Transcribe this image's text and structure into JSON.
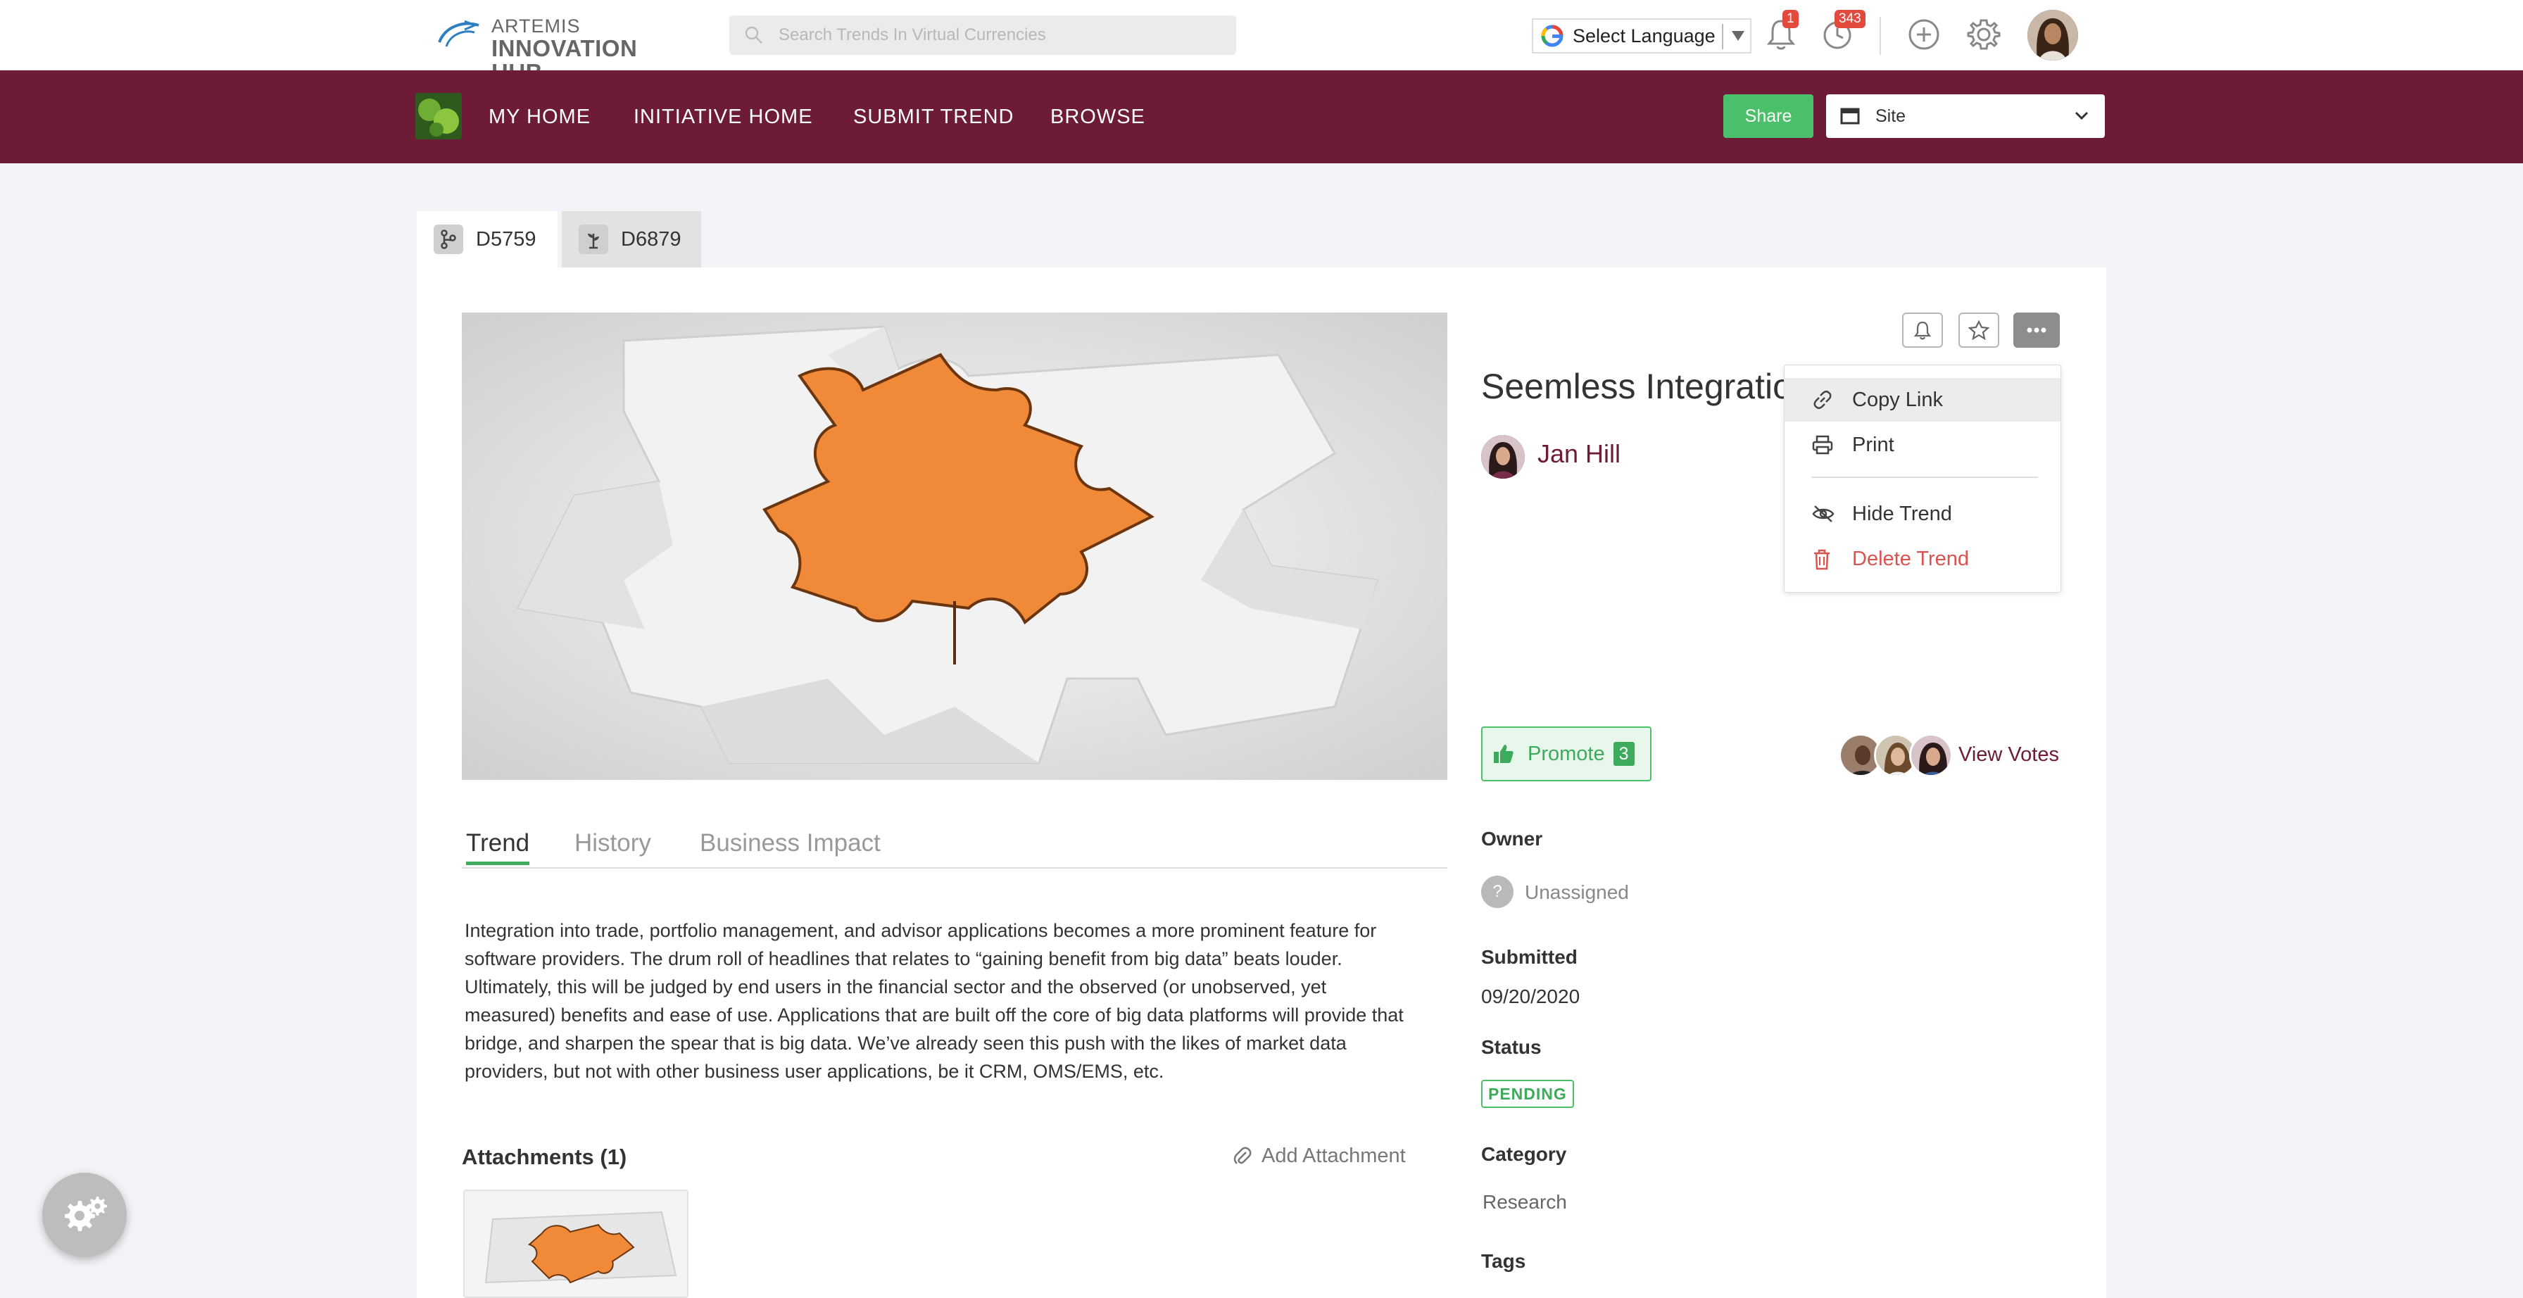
{
  "brand": {
    "line1": "ARTEMIS",
    "line2": "INNOVATION HUB",
    "accent": "#6d1b37"
  },
  "search": {
    "placeholder": "Search Trends In Virtual Currencies"
  },
  "language": {
    "label": "Select Language"
  },
  "notifications": {
    "bell_count": "1",
    "activity_count": "343"
  },
  "nav": {
    "items": [
      {
        "label": "MY HOME"
      },
      {
        "label": "INITIATIVE HOME"
      },
      {
        "label": "SUBMIT TREND"
      },
      {
        "label": "BROWSE"
      }
    ],
    "share_label": "Share",
    "site_label": "Site"
  },
  "id_tabs": [
    {
      "label": "D5759",
      "icon": "branch-icon"
    },
    {
      "label": "D6879",
      "icon": "plant-icon"
    }
  ],
  "trend": {
    "title": "Seemless Integration",
    "author": "Jan Hill",
    "promote_label": "Promote",
    "promote_count": "3",
    "view_votes": "View Votes",
    "tabs": [
      "Trend",
      "History",
      "Business Impact"
    ],
    "description": "Integration into trade, portfolio management, and advisor applications becomes a more prominent feature for software providers. The drum roll of headlines that relates to “gaining benefit from big data” beats louder. Ultimately, this will be judged by end users in the financial sector and the observed (or unobserved, yet measured) benefits and ease of use. Applications that are built off the core of big data platforms will provide that bridge, and sharpen the spear that is big data. We’ve already seen this push with the likes of market data providers, but not with other business user applications, be it CRM, OMS/EMS, etc."
  },
  "menu": {
    "items": [
      {
        "label": "Copy Link",
        "icon": "link-icon"
      },
      {
        "label": "Print",
        "icon": "printer-icon"
      },
      {
        "label": "Hide Trend",
        "icon": "eye-off-icon"
      },
      {
        "label": "Delete Trend",
        "icon": "trash-icon"
      }
    ]
  },
  "attachments": {
    "heading": "Attachments (1)",
    "add_label": "Add Attachment"
  },
  "meta": {
    "owner_label": "Owner",
    "owner_value": "Unassigned",
    "owner_icon_text": "?",
    "submitted_label": "Submitted",
    "submitted_value": "09/20/2020",
    "status_label": "Status",
    "status_value": "PENDING",
    "category_label": "Category",
    "category_value": "Research",
    "tags_label": "Tags"
  },
  "colors": {
    "primary": "#6d1b37",
    "success": "#4cbf6a",
    "danger": "#d9534f",
    "puzzle": "#f08a38"
  }
}
